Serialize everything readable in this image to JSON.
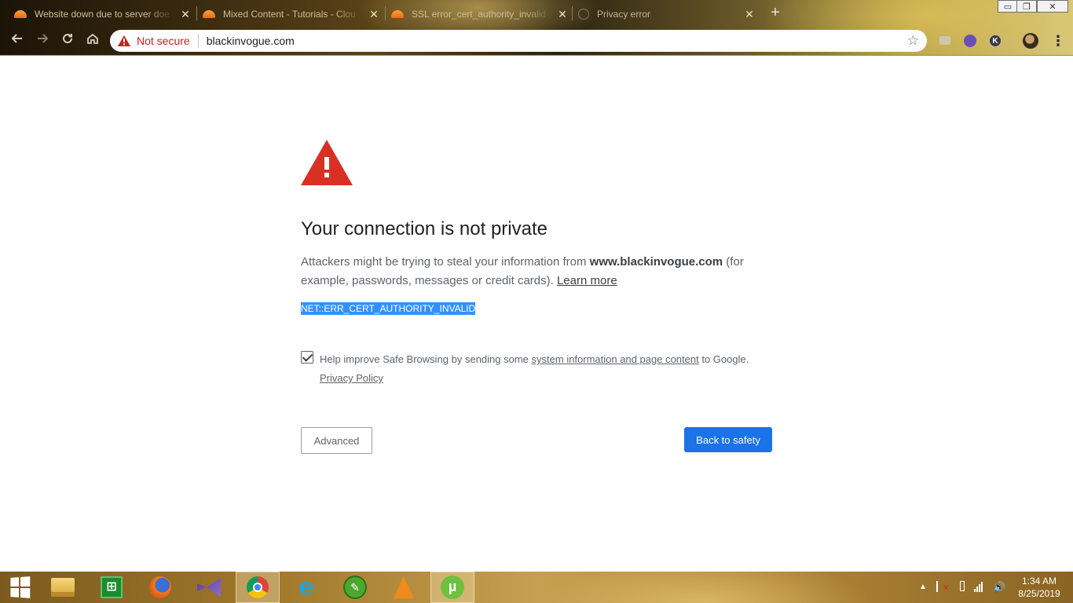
{
  "browser": {
    "tabs": [
      {
        "title": "Website down due to server doe",
        "favicon": "cloudflare-icon"
      },
      {
        "title": "Mixed Content - Tutorials - Clou",
        "favicon": "cloudflare-icon"
      },
      {
        "title": "SSL error_cert_authority_invalid",
        "favicon": "cloudflare-icon"
      },
      {
        "title": "Privacy error",
        "favicon": "globe-icon",
        "active": true
      }
    ],
    "new_tab": "+",
    "close_glyph": "✕",
    "omnibox": {
      "security_label": "Not secure",
      "url": "blackinvogue.com"
    },
    "window_buttons": {
      "minimize": "▭",
      "maximize": "❐",
      "close": "✕"
    },
    "extensions": [
      {
        "name": "cast-icon"
      },
      {
        "name": "purple-extension-icon"
      },
      {
        "name": "k-extension-icon",
        "label": "K"
      }
    ]
  },
  "interstitial": {
    "heading": "Your connection is not private",
    "explanation": {
      "prefix": "Attackers might be trying to steal your information from ",
      "domain": "www.blackinvogue.com",
      "suffix": " (for example, passwords, messages or credit cards). ",
      "learn_more": "Learn more"
    },
    "error_code": "NET::ERR_CERT_AUTHORITY_INVALID",
    "safe_browsing": {
      "checked": true,
      "prefix": "Help improve Safe Browsing by sending some ",
      "link": "system information and page content",
      "suffix": " to Google.",
      "privacy_link": "Privacy Policy"
    },
    "advanced_label": "Advanced",
    "back_label": "Back to safety",
    "colors": {
      "warning_red": "#d93025",
      "primary_blue": "#1a73e8"
    }
  },
  "taskbar": {
    "apps": [
      "start-button",
      "file-explorer",
      "windows-store",
      "firefox",
      "visual-studio",
      "chrome",
      "internet-explorer",
      "green-app",
      "vlc",
      "utorrent"
    ],
    "active_app": "chrome",
    "store_glyph": "⊞",
    "ie_glyph": "e",
    "green_app_glyph": "✎",
    "utorrent_glyph": "µ",
    "tray_arrow": "▲",
    "volume_glyph": "🔊",
    "clock": {
      "time": "1:34 AM",
      "date": "8/25/2019"
    }
  }
}
